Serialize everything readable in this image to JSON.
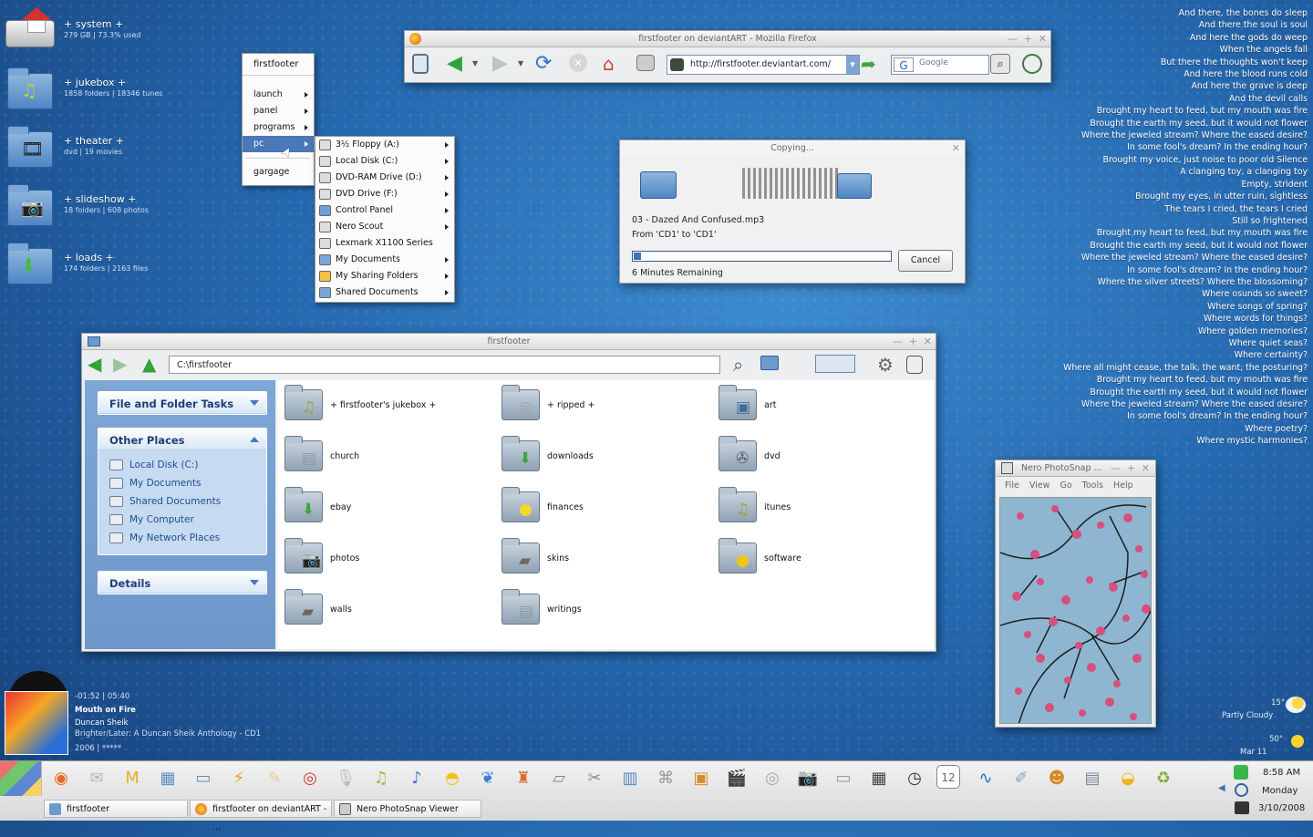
{
  "desktop": {
    "items": [
      {
        "title": "+ system +",
        "sub": "279 GB | 73.3% used",
        "icon": "home-drive-icon"
      },
      {
        "title": "+ jukebox +",
        "sub": "1858 folders | 18346 tunes",
        "icon": "music-folder-icon",
        "glyph": "♫"
      },
      {
        "title": "+ theater +",
        "sub": "dvd | 19 movies",
        "icon": "film-folder-icon",
        "glyph": "🎞"
      },
      {
        "title": "+ slideshow +",
        "sub": "18 folders | 608 photos",
        "icon": "camera-folder-icon",
        "glyph": "📷"
      },
      {
        "title": "+ loads +",
        "sub": "174 folders | 2163 files",
        "icon": "download-folder-icon",
        "glyph": "⬇"
      }
    ],
    "lyrics": [
      "And there, the bones do sleep",
      "And there the soul is soul",
      "And here the gods do weep",
      "When the angels fall",
      "But there the thoughts won't keep",
      "And here the blood runs cold",
      "And here the grave is deep",
      "And the devil calls",
      "Brought my heart to feed, but my mouth was fire",
      "Brought the earth my seed, but it would not flower",
      "Where the jeweled stream? Where the eased desire?",
      "In some fool's dream? In the ending hour?",
      "Brought my voice, just noise to poor old Silence",
      "A clanging toy, a clanging toy",
      "Empty, strident",
      "Brought my eyes, in utter ruin, sightless",
      "The tears I cried, the tears I cried",
      "Still so frightened",
      "Brought my heart to feed, but my mouth was fire",
      "Brought the earth my seed, but it would not flower",
      "Where the jeweled stream? Where the eased desire?",
      "In some fool's dream? In the ending hour?",
      "Where the silver streets? Where the blossoming?",
      "Where osunds so sweet?",
      "Where songs of spring?",
      "Where words for things?",
      "Where golden memories?",
      "Where quiet seas?",
      "Where certainty?",
      "Where all might cease, the talk, the want, the posturing?",
      "Brought my heart to feed, but my mouth was fire",
      "Brought the earth my seed, but it would not flower",
      "Where the jeweled stream? Where the eased desire?",
      "In some fool's dream? In the ending hour?",
      "Where poetry?",
      "Where mystic harmonies?"
    ]
  },
  "start_menu": {
    "header": "firstfooter",
    "items": [
      "launch",
      "panel",
      "programs",
      "pc"
    ],
    "footer": "gargage",
    "selected": "pc"
  },
  "pc_submenu": [
    "3½ Floppy (A:)",
    "Local Disk (C:)",
    "DVD-RAM Drive (D:)",
    "DVD Drive (F:)",
    "Control Panel",
    "Nero Scout",
    "Lexmark X1100 Series",
    "My Documents",
    "My Sharing Folders",
    "Shared Documents"
  ],
  "firefox": {
    "title": "firstfooter on deviantART - Mozilla Firefox",
    "url": "http://firstfooter.deviantart.com/",
    "search_placeholder": "Google",
    "search_engine": "G"
  },
  "copy_dialog": {
    "title": "Copying...",
    "file": "03 - Dazed And Confused.mp3",
    "from_to": "From 'CD1' to 'CD1'",
    "remaining": "6 Minutes Remaining",
    "progress": 0.03,
    "cancel_label": "Cancel"
  },
  "explorer": {
    "title": "firstfooter",
    "address": "C:\\firstfooter",
    "tasks_header": "File and Folder Tasks",
    "places_header": "Other Places",
    "details_header": "Details",
    "places": [
      "Local Disk (C:)",
      "My Documents",
      "Shared Documents",
      "My Computer",
      "My Network Places"
    ],
    "folders": [
      {
        "name": "+ firstfooter's jukebox +",
        "icon": "music-folder-icon",
        "glyph": "♫",
        "color": "#8fae2c"
      },
      {
        "name": "+ ripped +",
        "icon": "cd-folder-icon",
        "glyph": "◎",
        "color": "#9aa4ad"
      },
      {
        "name": "art",
        "icon": "picture-folder-icon",
        "glyph": "▣",
        "color": "#3f6c9e"
      },
      {
        "name": "church",
        "icon": "document-folder-icon",
        "glyph": "▤",
        "color": "#8b99a6"
      },
      {
        "name": "downloads",
        "icon": "download-folder-icon",
        "glyph": "⬇",
        "color": "#3fa53a"
      },
      {
        "name": "dvd",
        "icon": "film-folder-icon",
        "glyph": "✇",
        "color": "#555d66"
      },
      {
        "name": "ebay",
        "icon": "download-folder-icon",
        "glyph": "⬇",
        "color": "#3fa53a"
      },
      {
        "name": "finances",
        "icon": "sun-folder-icon",
        "glyph": "●",
        "color": "#f3d92a"
      },
      {
        "name": "itunes",
        "icon": "music-folder-icon",
        "glyph": "♫",
        "color": "#8fae2c"
      },
      {
        "name": "photos",
        "icon": "camera-folder-icon",
        "glyph": "📷",
        "color": "#333"
      },
      {
        "name": "skins",
        "icon": "skins-folder-icon",
        "glyph": "▰",
        "color": "#6f6a58"
      },
      {
        "name": "software",
        "icon": "software-folder-icon",
        "glyph": "●",
        "color": "#f0c814"
      },
      {
        "name": "walls",
        "icon": "walls-folder-icon",
        "glyph": "▰",
        "color": "#6f6a58"
      },
      {
        "name": "writings",
        "icon": "document-folder-icon",
        "glyph": "▤",
        "color": "#8b99a6"
      }
    ]
  },
  "photosnap": {
    "title": "Nero PhotoSnap ...",
    "menu": [
      "File",
      "View",
      "Go",
      "Tools",
      "Help"
    ]
  },
  "now_playing": {
    "time": "-01:52 | 05:40",
    "track": "Mouth on Fire",
    "artist": "Duncan Sheik",
    "album": "Brighter/Later: A Duncan Sheik Anthology - CD1",
    "year_rating": "2006 | *****"
  },
  "weather": {
    "temp1": "15°",
    "cond": "Partly Cloudy",
    "temp2": "50°",
    "date": "Mar 11"
  },
  "clock": {
    "time": "8:58 AM",
    "day": "Monday",
    "date": "3/10/2008"
  },
  "tasks": [
    {
      "label": "firstfooter",
      "icon": "folder-icon"
    },
    {
      "label": "firstfooter on deviantART - ...",
      "icon": "firefox-icon"
    },
    {
      "label": "Nero PhotoSnap Viewer",
      "icon": "photosnap-icon"
    }
  ],
  "quicklaunch": [
    {
      "icon": "firefox-icon",
      "glyph": "◉",
      "color": "#e66a1f"
    },
    {
      "icon": "mail-icon",
      "glyph": "✉",
      "color": "#b8b8b8"
    },
    {
      "icon": "m-app-icon",
      "glyph": "M",
      "color": "#e7b11f"
    },
    {
      "icon": "pictures-folder-icon",
      "glyph": "▦",
      "color": "#5e8fc6"
    },
    {
      "icon": "folder-icon",
      "glyph": "▭",
      "color": "#5e8fc6"
    },
    {
      "icon": "winamp-icon",
      "glyph": "⚡",
      "color": "#f09a1c"
    },
    {
      "icon": "notepad-icon",
      "glyph": "✎",
      "color": "#e3cf8e"
    },
    {
      "icon": "cd-burn-icon",
      "glyph": "◎",
      "color": "#cf3b3b"
    },
    {
      "icon": "microphone-icon",
      "glyph": "🎙",
      "color": "#bbbbbb"
    },
    {
      "icon": "music-icon",
      "glyph": "♫",
      "color": "#9bbf3a"
    },
    {
      "icon": "itunes-icon",
      "glyph": "♪",
      "color": "#4a7bd0"
    },
    {
      "icon": "hardhat-icon",
      "glyph": "◓",
      "color": "#f2c21b"
    },
    {
      "icon": "footprints-icon",
      "glyph": "❦",
      "color": "#3b7fd0"
    },
    {
      "icon": "joystick-icon",
      "glyph": "♜",
      "color": "#d96c2b"
    },
    {
      "icon": "scanner-icon",
      "glyph": "▱",
      "color": "#7b8794"
    },
    {
      "icon": "tools-icon",
      "glyph": "✂",
      "color": "#8a8f96"
    },
    {
      "icon": "hardware-icon",
      "glyph": "▥",
      "color": "#5b85c0"
    },
    {
      "icon": "mouse-icon",
      "glyph": "⌘",
      "color": "#999999"
    },
    {
      "icon": "box-icon",
      "glyph": "▣",
      "color": "#d88a2a"
    },
    {
      "icon": "clapper-icon",
      "glyph": "🎬",
      "color": "#333333"
    },
    {
      "icon": "disc-icon",
      "glyph": "◎",
      "color": "#aaaaaa"
    },
    {
      "icon": "camera-icon",
      "glyph": "📷",
      "color": "#444444"
    },
    {
      "icon": "drive-icon",
      "glyph": "▭",
      "color": "#999999"
    },
    {
      "icon": "calculator-icon",
      "glyph": "▦",
      "color": "#444444"
    },
    {
      "icon": "clock-icon",
      "glyph": "◷",
      "color": "#333333"
    },
    {
      "icon": "calendar-icon",
      "glyph": "12",
      "color": "#666666"
    },
    {
      "icon": "monitor-icon",
      "glyph": "∿",
      "color": "#2c6fb5"
    },
    {
      "icon": "brush-icon",
      "glyph": "✐",
      "color": "#8aa0b8"
    },
    {
      "icon": "users-icon",
      "glyph": "☻",
      "color": "#d58a1e"
    },
    {
      "icon": "gnome-icon",
      "glyph": "▤",
      "color": "#7a86a0"
    },
    {
      "icon": "satellite-icon",
      "glyph": "◒",
      "color": "#f0b21a"
    },
    {
      "icon": "recycle-bin-icon",
      "glyph": "♻",
      "color": "#7fae3a"
    }
  ]
}
